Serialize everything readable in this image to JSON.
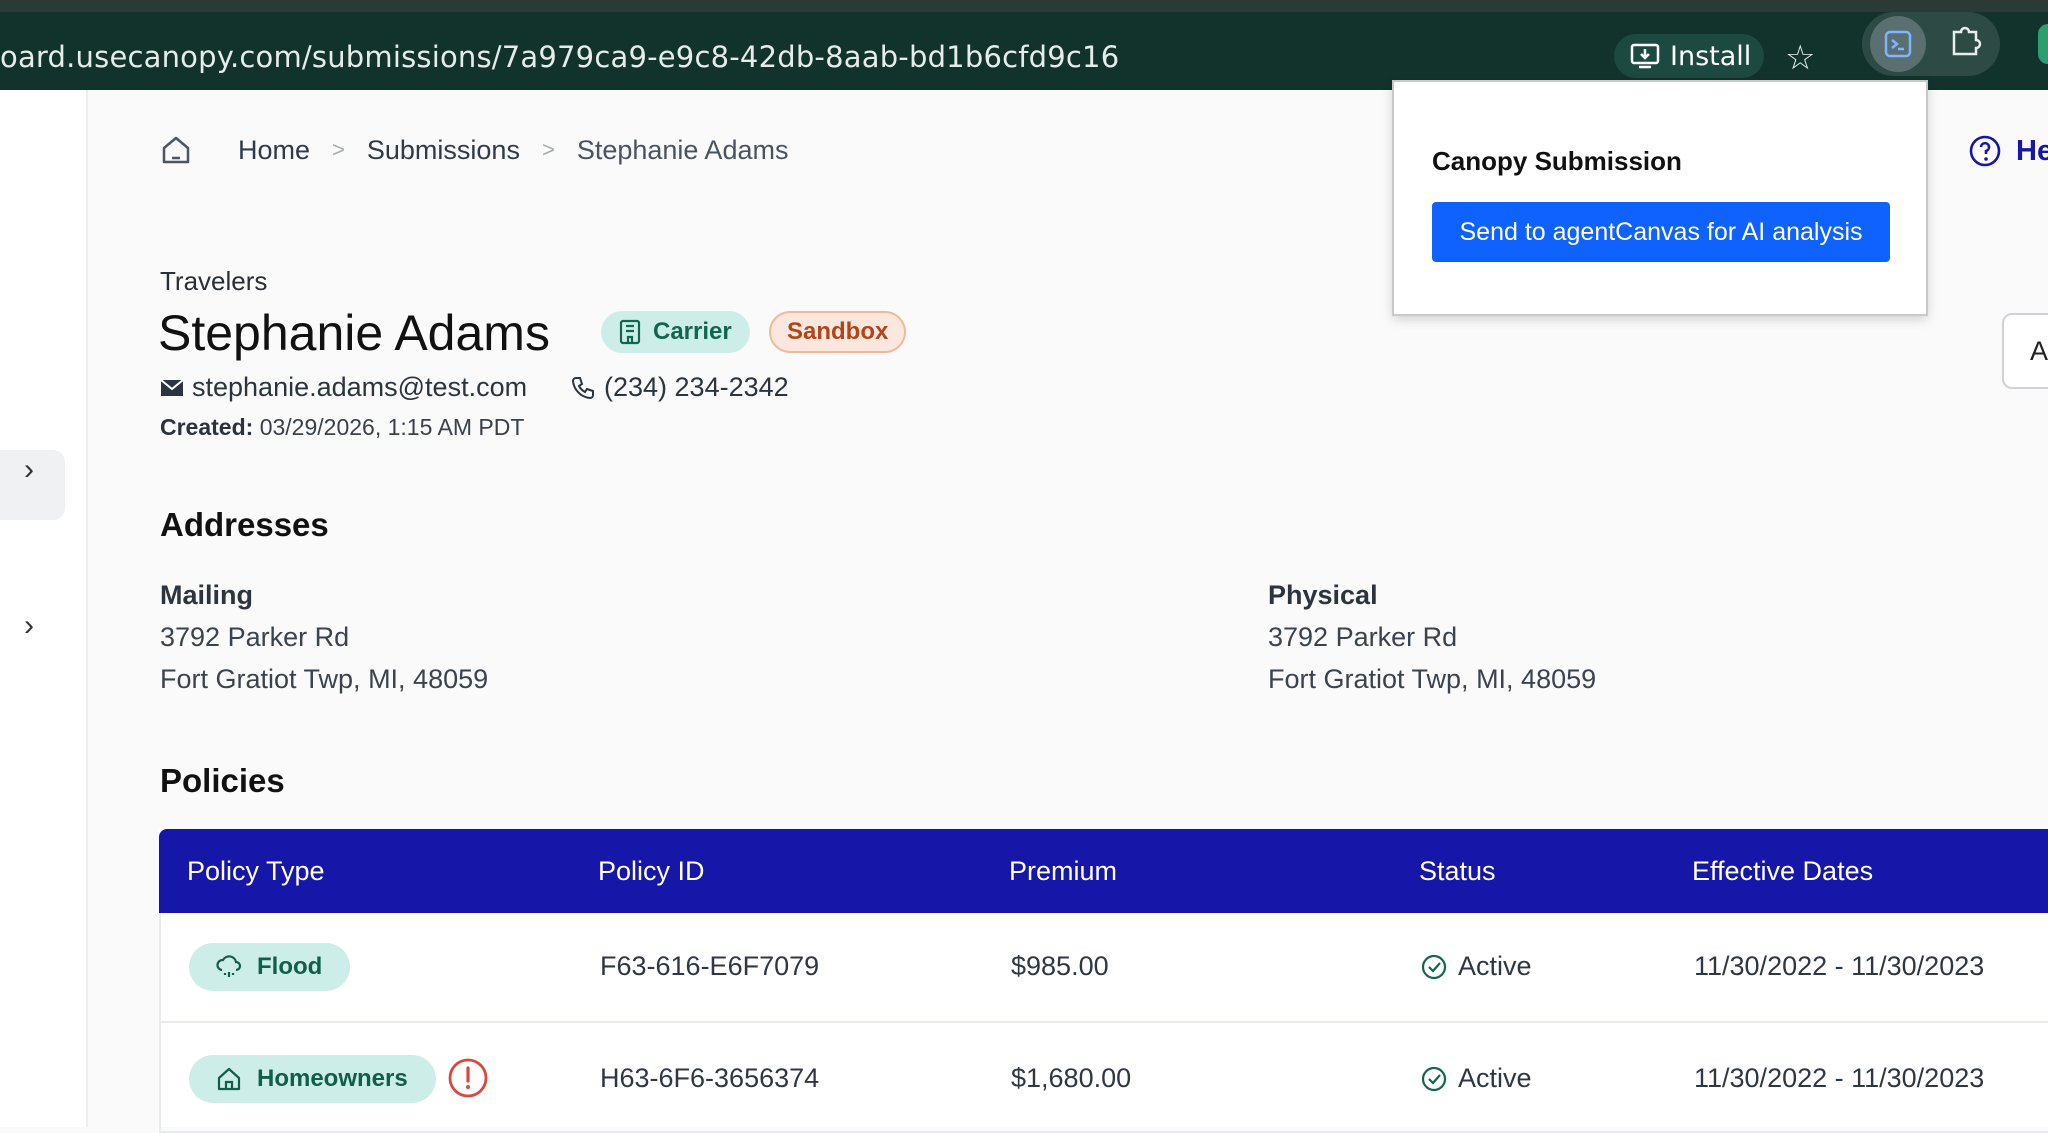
{
  "browser": {
    "url": "oard.usecanopy.com/submissions/7a979ca9-e9c8-42db-8aab-bd1b6cfd9c16",
    "install_label": "Install"
  },
  "breadcrumb": {
    "home": "Home",
    "submissions": "Submissions",
    "current": "Stephanie Adams"
  },
  "header": {
    "company": "Travelers",
    "name": "Stephanie Adams",
    "badge_carrier": "Carrier",
    "badge_sandbox": "Sandbox",
    "email": "stephanie.adams@test.com",
    "phone": "(234) 234-2342",
    "created_label": "Created:",
    "created_value": "03/29/2026, 1:15 AM PDT"
  },
  "help_label": "He",
  "right_button_label": "A",
  "addresses": {
    "title": "Addresses",
    "mailing": {
      "label": "Mailing",
      "line1": "3792 Parker Rd",
      "line2": "Fort Gratiot Twp, MI, 48059"
    },
    "physical": {
      "label": "Physical",
      "line1": "3792 Parker Rd",
      "line2": "Fort Gratiot Twp, MI, 48059"
    }
  },
  "policies": {
    "title": "Policies",
    "columns": [
      "Policy Type",
      "Policy ID",
      "Premium",
      "Status",
      "Effective Dates"
    ],
    "rows": [
      {
        "type": "Flood",
        "id": "F63-616-E6F7079",
        "premium": "$985.00",
        "status": "Active",
        "dates": "11/30/2022 - 11/30/2023"
      },
      {
        "type": "Homeowners",
        "id": "H63-6F6-3656374",
        "premium": "$1,680.00",
        "status": "Active",
        "dates": "11/30/2022 - 11/30/2023"
      }
    ]
  },
  "popup": {
    "title": "Canopy Submission",
    "button": "Send to agentCanvas for AI analysis"
  },
  "colors": {
    "table_header": "#1616a8",
    "carrier_badge_bg": "#cdeee8",
    "sandbox_text": "#b0451a",
    "popup_button": "#0f62fe",
    "status_icon": "#11664f"
  }
}
